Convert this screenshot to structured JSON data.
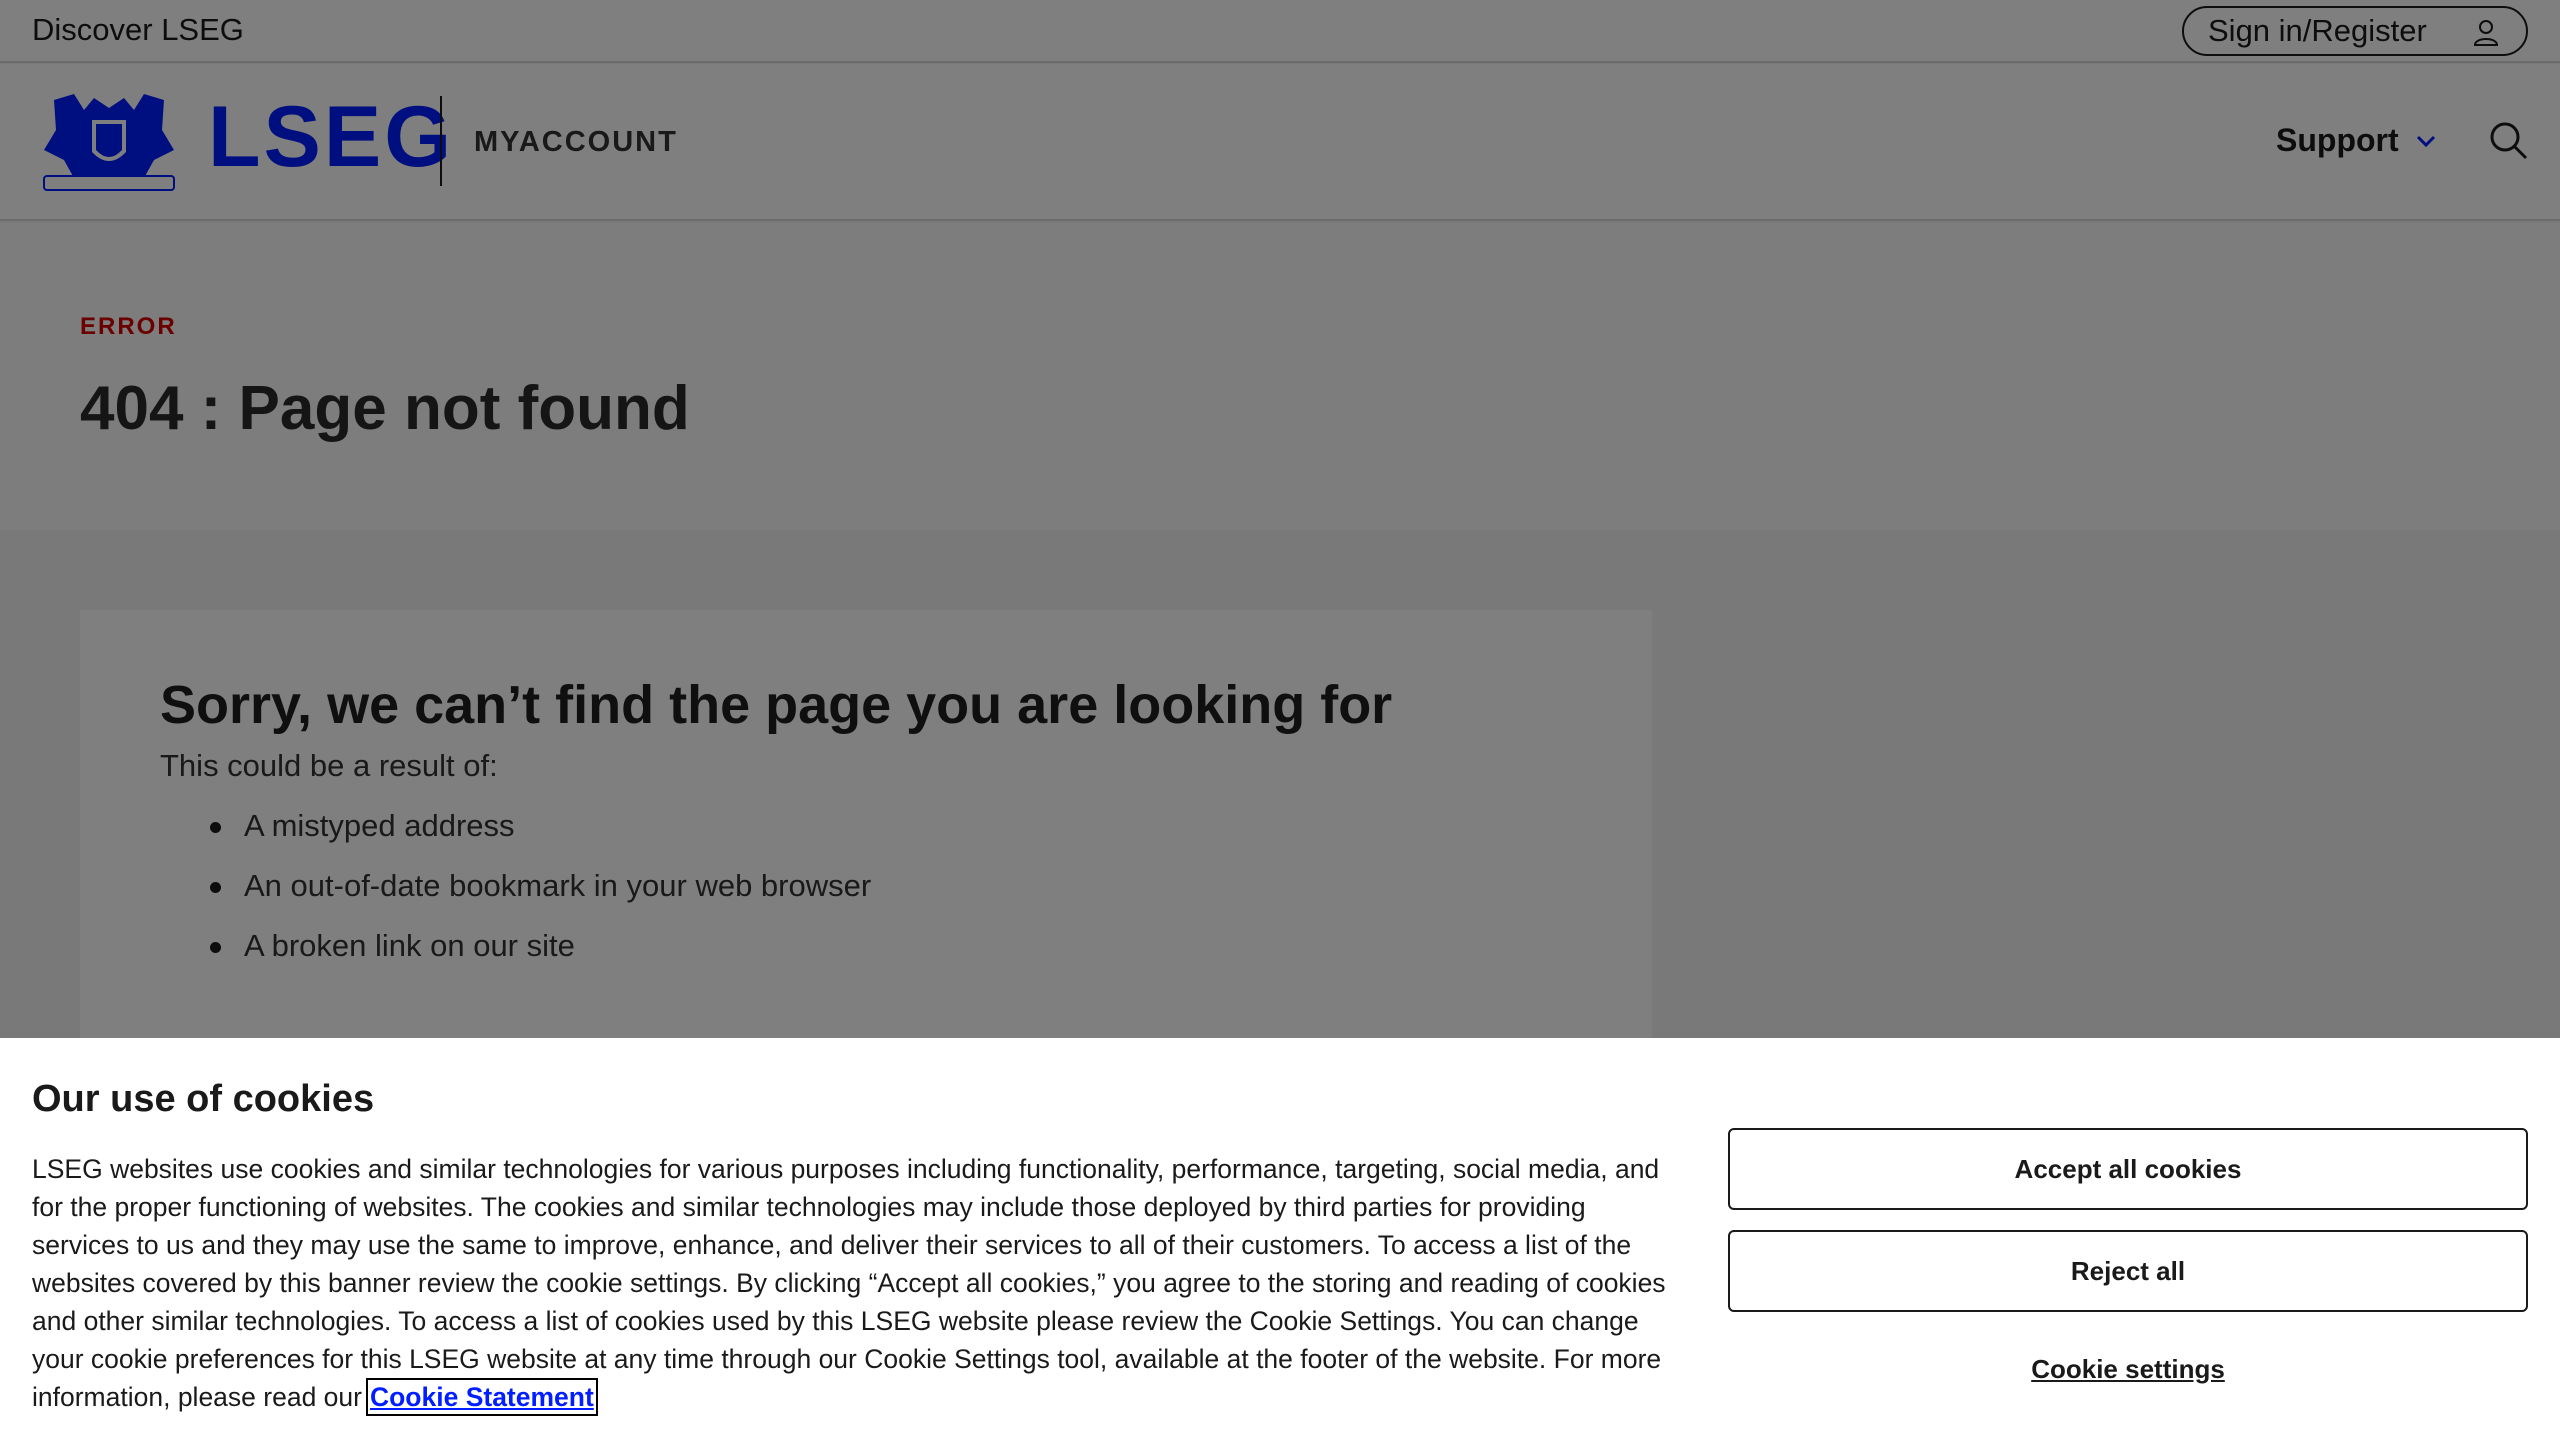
{
  "utility_bar": {
    "discover_label": "Discover LSEG",
    "signin_label": "Sign in/Register"
  },
  "header": {
    "logo_text": "LSEG",
    "section_label": "MYACCOUNT",
    "support_label": "Support",
    "brand_color": "#001eff"
  },
  "hero": {
    "eyebrow": "ERROR",
    "title": "404 : Page not found",
    "eyebrow_color": "#d60000"
  },
  "card": {
    "heading": "Sorry, we can’t find the page you are looking for",
    "intro": "This could be a result of:",
    "reasons": [
      "A mistyped address",
      "An out-of-date bookmark in your web browser",
      "A broken link on our site"
    ]
  },
  "cookies": {
    "title": "Our use of cookies",
    "body": "LSEG websites use cookies and similar technologies for various purposes including functionality, performance, targeting, social media, and for the proper functioning of websites. The cookies and similar technologies may include those deployed by third parties for providing services to us and they may use the same to improve, enhance, and deliver their services to all of their customers. To access a list of the websites covered by this banner review the cookie settings. By clicking “Accept all cookies,” you agree to the storing and reading of cookies and other similar technologies. To access a list of cookies used by this LSEG website please review the Cookie Settings. You can change your cookie preferences for this LSEG website at any time through our Cookie Settings tool, available at the footer of the website. For more information, please read our",
    "statement_link": "Cookie Statement",
    "accept_label": "Accept all cookies",
    "reject_label": "Reject all",
    "settings_label": "Cookie settings"
  }
}
